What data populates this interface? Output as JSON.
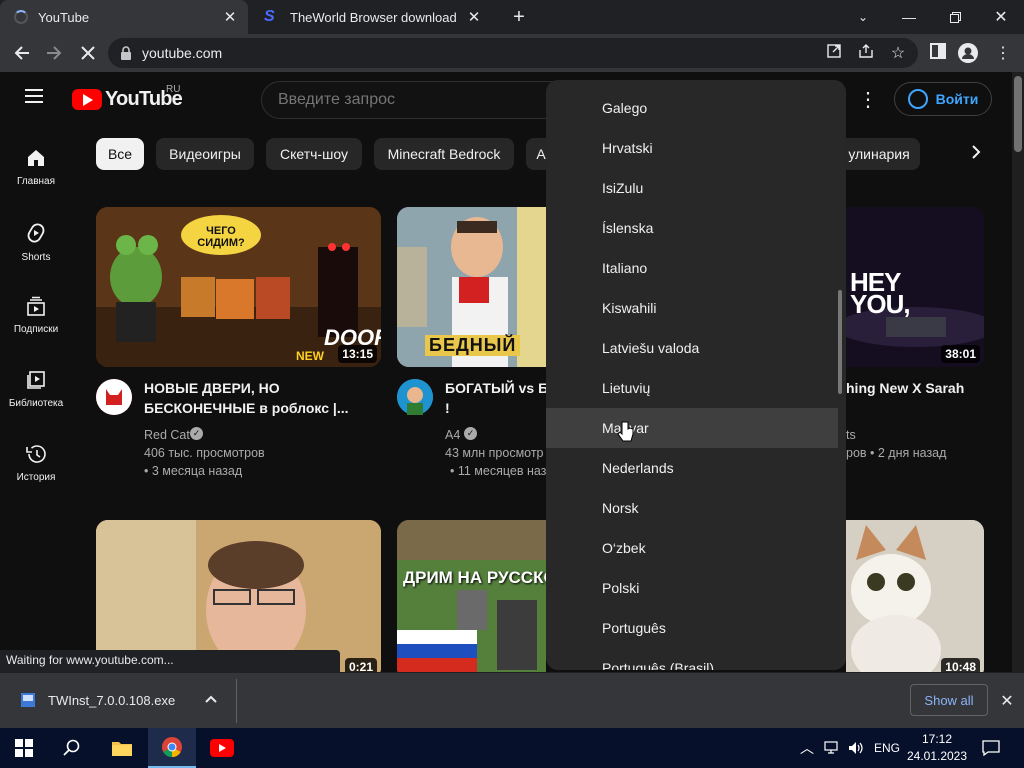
{
  "browser": {
    "tabs": [
      {
        "title": "YouTube",
        "active": true
      },
      {
        "title": "TheWorld Browser download sta",
        "active": false
      }
    ],
    "url": "youtube.com",
    "status_text": "Waiting for www.youtube.com...",
    "download": {
      "filename": "TWInst_7.0.0.108.exe",
      "show_all_label": "Show all"
    }
  },
  "youtube": {
    "logo_text": "YouTube",
    "region": "RU",
    "search_placeholder": "Введите запрос",
    "signin_label": "Войти",
    "sidebar": [
      {
        "label": "Главная",
        "icon": "home-icon"
      },
      {
        "label": "Shorts",
        "icon": "shorts-icon"
      },
      {
        "label": "Подписки",
        "icon": "subscriptions-icon"
      },
      {
        "label": "Библиотека",
        "icon": "library-icon"
      },
      {
        "label": "История",
        "icon": "history-icon"
      }
    ],
    "chips": [
      "Все",
      "Видеоигры",
      "Скетч-шоу",
      "Minecraft Bedrock",
      "А",
      "улинария"
    ],
    "videos": [
      {
        "title_line1": "НОВЫЕ ДВЕРИ, НО",
        "title_line2": "БЕСКОНЕЧНЫЕ в роблокс |...",
        "channel": "Red Cat",
        "views": "406 тыс. просмотров",
        "age": "• 3 месяца назад",
        "duration": "13:15"
      },
      {
        "title_line1": "БОГАТЫЙ vs БЕ",
        "title_line2": "!",
        "channel": "A4",
        "views": "43 млн просмотр",
        "age": "• 11 месяцев наз",
        "duration": ""
      },
      {
        "title_line1": "hing New X Sarah",
        "title_line2": "",
        "channel": "ts",
        "views": "ров • 2 дня назад",
        "age": "",
        "duration": "38:01"
      },
      {
        "title_line1": "",
        "title_line2": "",
        "channel": "",
        "views": "",
        "age": "",
        "duration": "0:21"
      },
      {
        "title_line1": "",
        "title_line2": "",
        "channel": "",
        "views": "",
        "age": "",
        "duration": ""
      },
      {
        "title_line1": "",
        "title_line2": "",
        "channel": "",
        "views": "",
        "age": "",
        "duration": "10:48"
      }
    ],
    "thumb_texts": {
      "t1_bubble": "ЧЕГО СИДИМ?",
      "t1_overlay": "DOORS",
      "t1_new": "NEW",
      "t2_overlay": "БЕДНЫЙ",
      "t3_overlay": "HEY YOU,",
      "t5_overlay": "ДРИМ НА РУССКО"
    },
    "languages": [
      "Galego",
      "Hrvatski",
      "IsiZulu",
      "Íslenska",
      "Italiano",
      "Kiswahili",
      "Latviešu valoda",
      "Lietuvių",
      "Magyar",
      "Nederlands",
      "Norsk",
      "O‘zbek",
      "Polski",
      "Português",
      "Português (Brasil)"
    ],
    "highlighted_language": "Magyar"
  },
  "taskbar": {
    "language": "ENG",
    "time": "17:12",
    "date": "24.01.2023"
  }
}
